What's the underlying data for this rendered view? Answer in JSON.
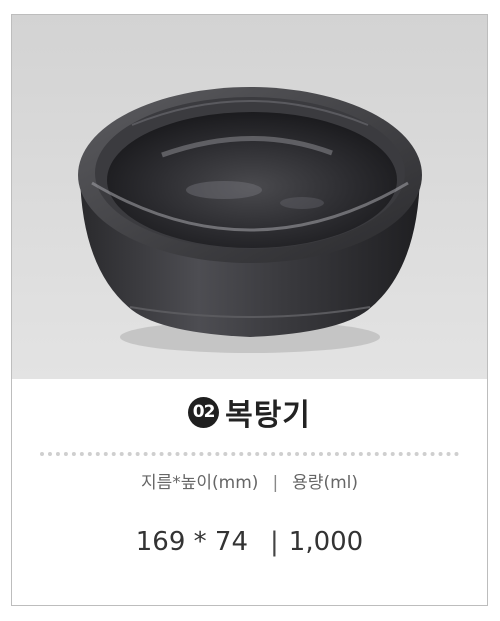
{
  "product": {
    "number": "02",
    "name": "복탕기",
    "image_icon": "black-stone-bowl-photo"
  },
  "specs": {
    "header_dimension": "지름*높이(mm)",
    "header_separator": "|",
    "header_capacity": "용량(ml)",
    "value_dimension": "169 * 74",
    "value_separator": "|",
    "value_capacity": "1,000"
  }
}
